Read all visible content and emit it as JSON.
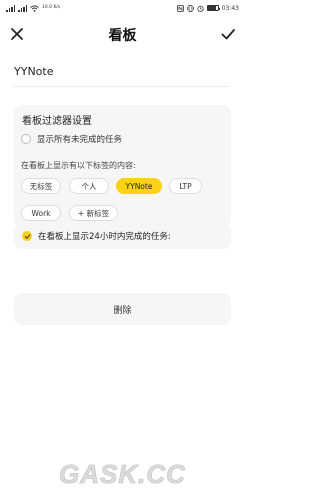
{
  "status_bar": {
    "carrier_info": "卡1 卡2",
    "net_speed": "10.0 K/s",
    "battery_level_percent": 80,
    "time": "03:43"
  },
  "header": {
    "title": "看板",
    "close_icon": "close-icon",
    "confirm_icon": "check-icon"
  },
  "board_name": {
    "value": "YYNote"
  },
  "filter": {
    "title": "看板过滤器设置",
    "show_all_label": "显示所有未完成的任务",
    "show_all_checked": false,
    "tags_label": "在看板上显示有以下标签的内容:",
    "tags": [
      {
        "label": "无标签",
        "selected": false
      },
      {
        "label": "个人",
        "selected": false
      },
      {
        "label": "YYNote",
        "selected": true
      },
      {
        "label": "LTP",
        "selected": false
      },
      {
        "label": "Work",
        "selected": false
      },
      {
        "label": "+ 新标签",
        "selected": false
      }
    ]
  },
  "completed_option": {
    "label": "在看板上显示24小时内完成的任务:",
    "checked": true
  },
  "delete_button": {
    "label": "删除"
  },
  "watermark": {
    "text": "GASK.CC"
  },
  "colors": {
    "accent": "#fcd116",
    "card_bg": "#f6f6f6",
    "text": "#222222"
  }
}
